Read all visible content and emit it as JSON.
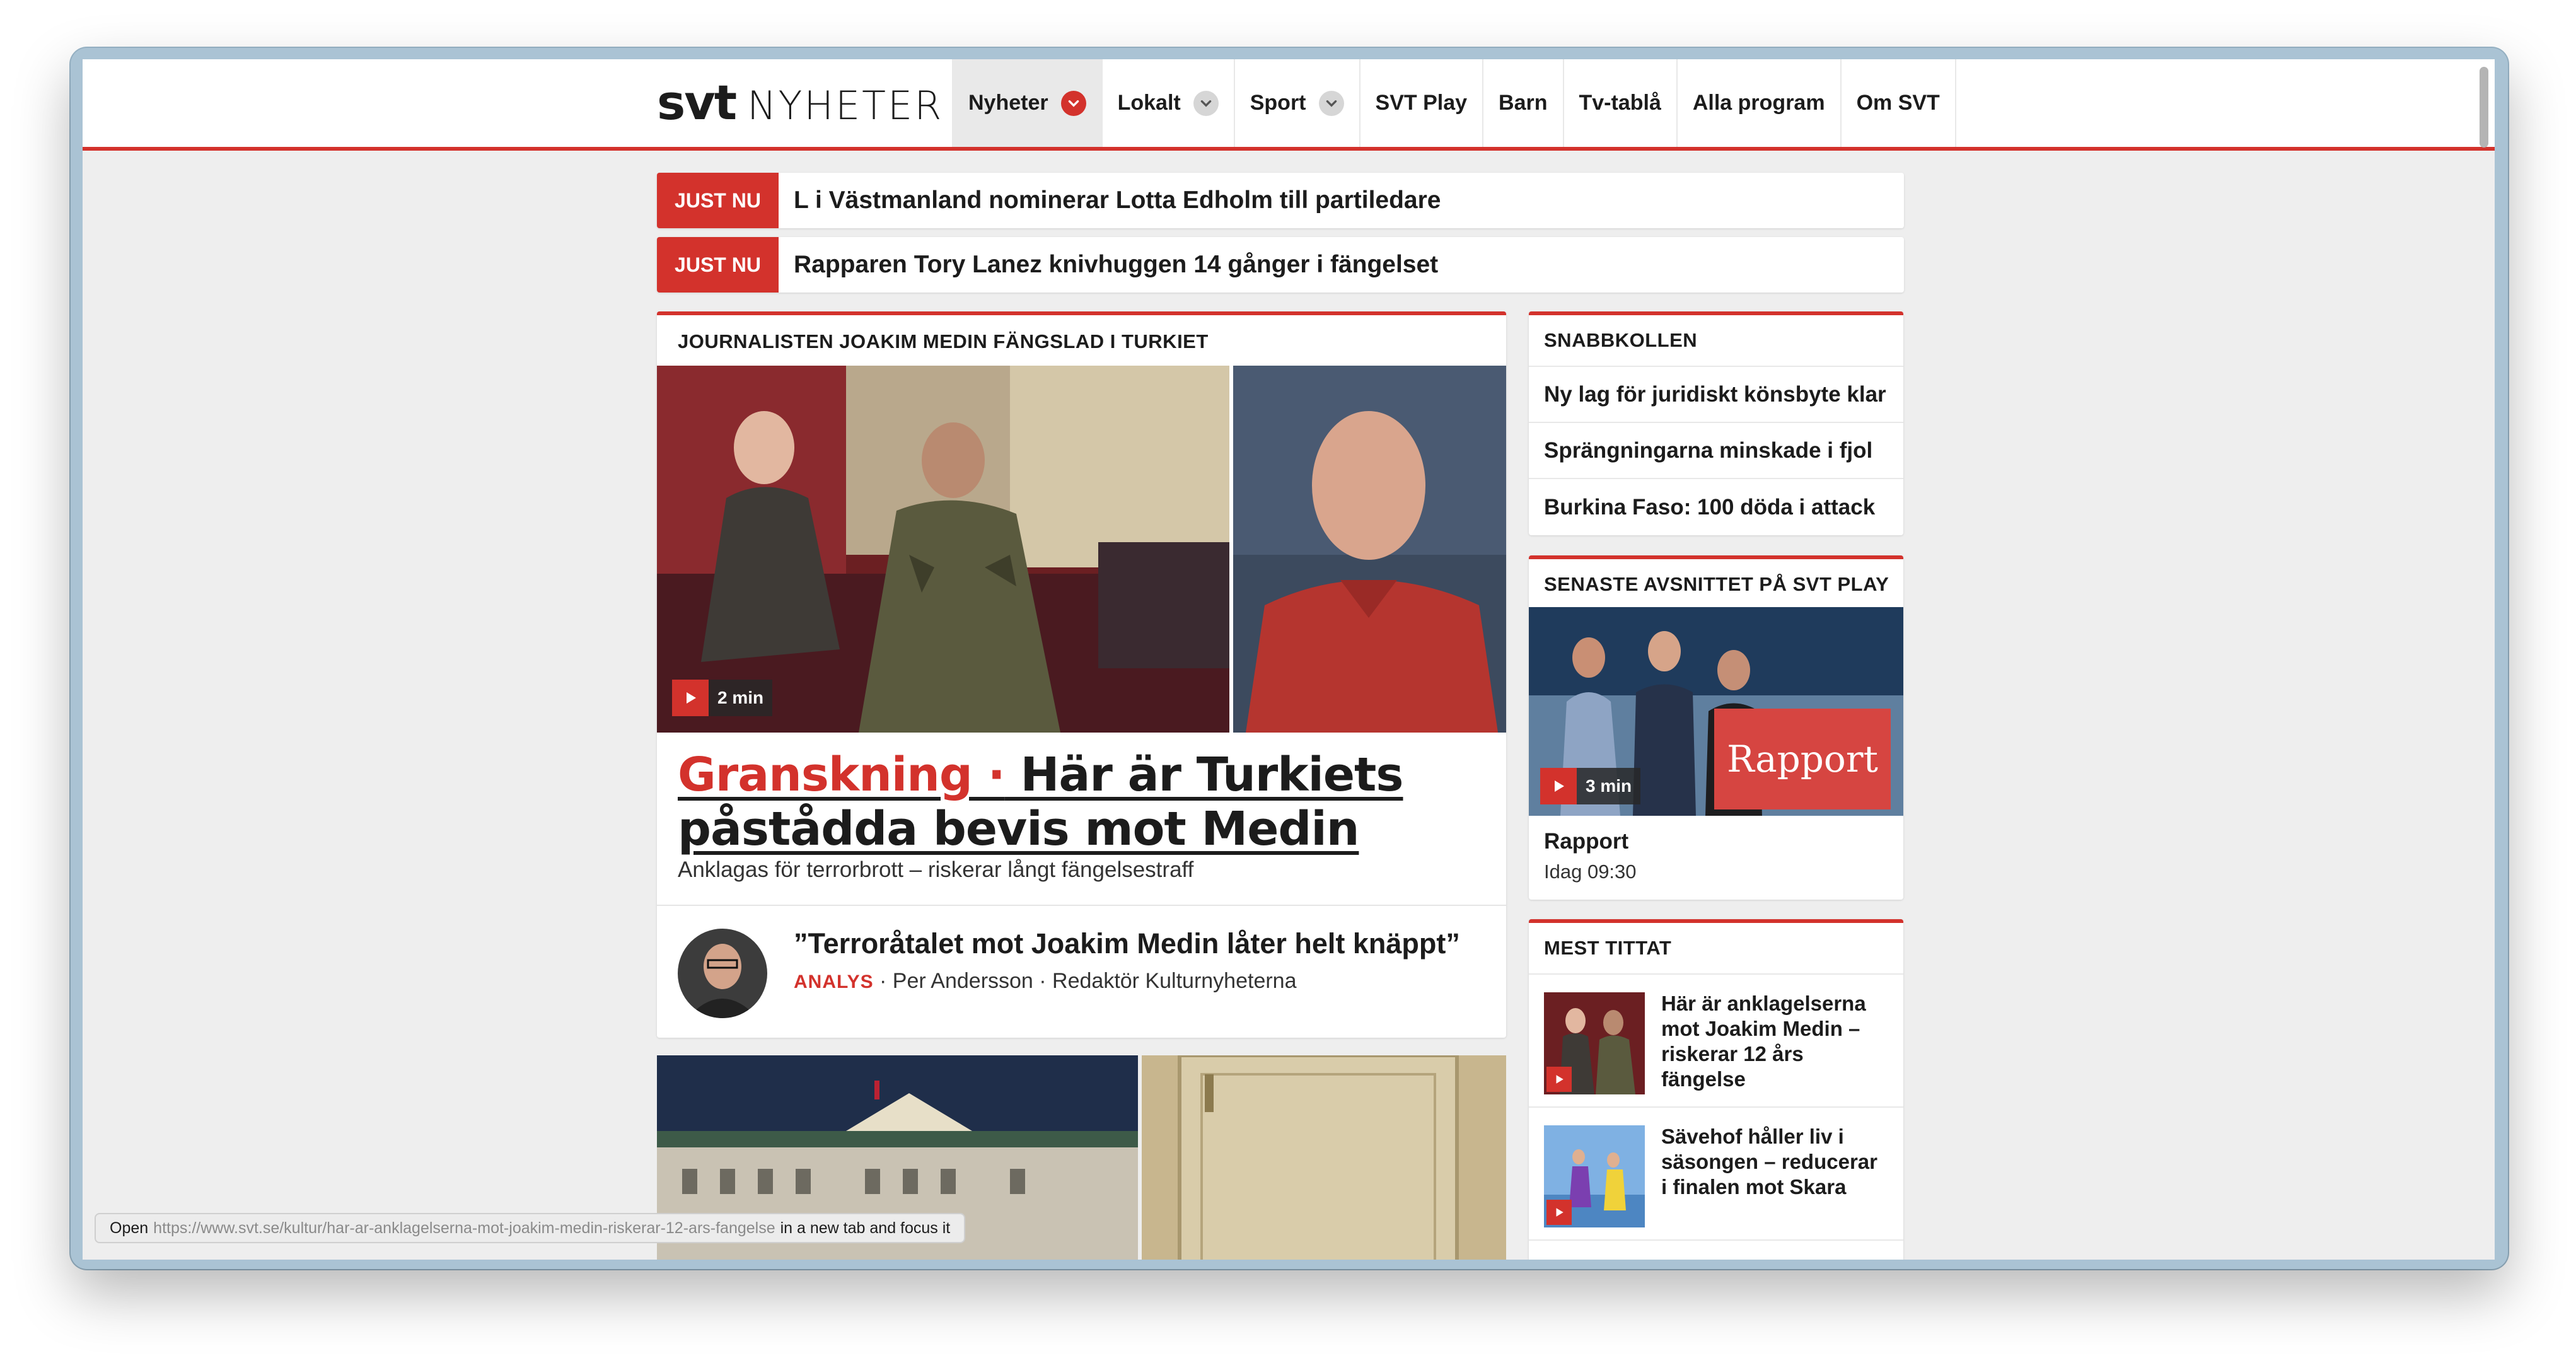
{
  "header": {
    "logo_svt": "svt",
    "logo_nyheter": "NYHETER",
    "nav": [
      {
        "label": "Nyheter",
        "has_chevron": true
      },
      {
        "label": "Lokalt",
        "has_chevron": true
      },
      {
        "label": "Sport",
        "has_chevron": true
      },
      {
        "label": "SVT Play"
      },
      {
        "label": "Barn"
      },
      {
        "label": "Tv-tablå"
      },
      {
        "label": "Alla program"
      },
      {
        "label": "Om SVT"
      }
    ]
  },
  "just_nu": [
    {
      "badge": "JUST NU",
      "text": "L i Västmanland nominerar Lotta Edholm till partiledare"
    },
    {
      "badge": "JUST NU",
      "text": "Rapparen Tory Lanez knivhuggen 14 gånger i fängelset"
    }
  ],
  "main": {
    "section": "JOURNALISTEN JOAKIM MEDIN FÄNGSLAD I TURKIET",
    "video_duration": "2 min",
    "kicker": "Granskning ·",
    "headline": " Här är Turkiets påstådda bevis mot Medin",
    "subline": "Anklagas för terrorbrott – riskerar långt fängelsestraff",
    "analysis": {
      "quote": "”Terroråtalet mot Joakim Medin låter helt knäppt”",
      "tag": "ANALYS",
      "byline": " · Per Andersson · Redaktör Kulturnyheterna"
    }
  },
  "snabbkollen": {
    "title": "SNABBKOLLEN",
    "items": [
      "Ny lag för juridiskt könsbyte klar",
      "Sprängningarna minskade i fjol",
      "Burkina Faso: 100 döda i attack"
    ]
  },
  "svtplay": {
    "title": "SENASTE AVSNITTET PÅ SVT PLAY",
    "duration": "3 min",
    "logo_text": "Rapport",
    "program": "Rapport",
    "time": "Idag 09:30"
  },
  "mest_tittat": {
    "title": "MEST TITTAT",
    "items": [
      "Här är anklagelserna mot Joakim Medin – riskerar 12 års fängelse",
      "Sävehof håller liv i säsongen – reducerar i finalen mot Skara"
    ]
  },
  "status_bar": {
    "prefix": "Open",
    "url": "https://www.svt.se/kultur/har-ar-anklagelserna-mot-joakim-medin-riskerar-12-ars-fangelse",
    "suffix": "in a new tab and focus it"
  },
  "colors": {
    "accent": "#d3322c",
    "background": "#eeeeee"
  }
}
